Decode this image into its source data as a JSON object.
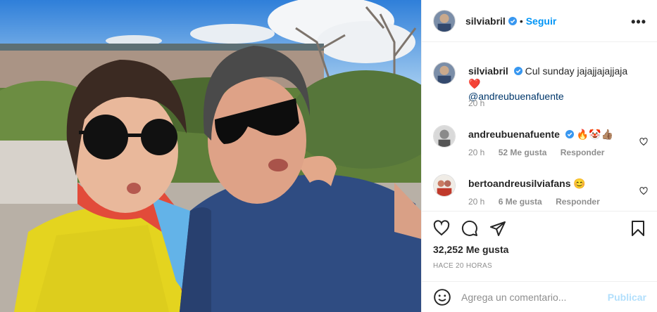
{
  "author": {
    "username": "silviabril",
    "follow_label": "Seguir",
    "separator": "•",
    "more_label": "•••"
  },
  "caption": {
    "username": "silviabril",
    "text": "Cul sunday jajajjajajjaja",
    "emoji": "❤️",
    "mention": "@andreubuenafuente",
    "time": "20 h"
  },
  "comments": [
    {
      "username": "andreubuenafuente",
      "text": "🔥🤡👍🏽",
      "time": "20 h",
      "likes": "52 Me gusta",
      "reply": "Responder"
    },
    {
      "username": "bertoandreusilviafans",
      "text": "😊",
      "time": "20 h",
      "likes": "6 Me gusta",
      "reply": "Responder"
    }
  ],
  "stats": {
    "likes": "32,252 Me gusta",
    "timeago": "HACE 20 HORAS"
  },
  "add_comment": {
    "placeholder": "Agrega un comentario...",
    "publish_label": "Publicar"
  },
  "icons": {
    "verified": "verified-badge-icon",
    "like": "heart-icon",
    "comment": "comment-bubble-icon",
    "share": "paper-plane-icon",
    "save": "bookmark-icon",
    "emoji": "smiley-icon",
    "options": "ellipsis-icon"
  },
  "colors": {
    "link_blue": "#0095f6",
    "publish_disabled": "#b2dffc",
    "secondary_text": "#8e8e8e",
    "verified_blue": "#3897f0",
    "mention": "#00376b"
  }
}
